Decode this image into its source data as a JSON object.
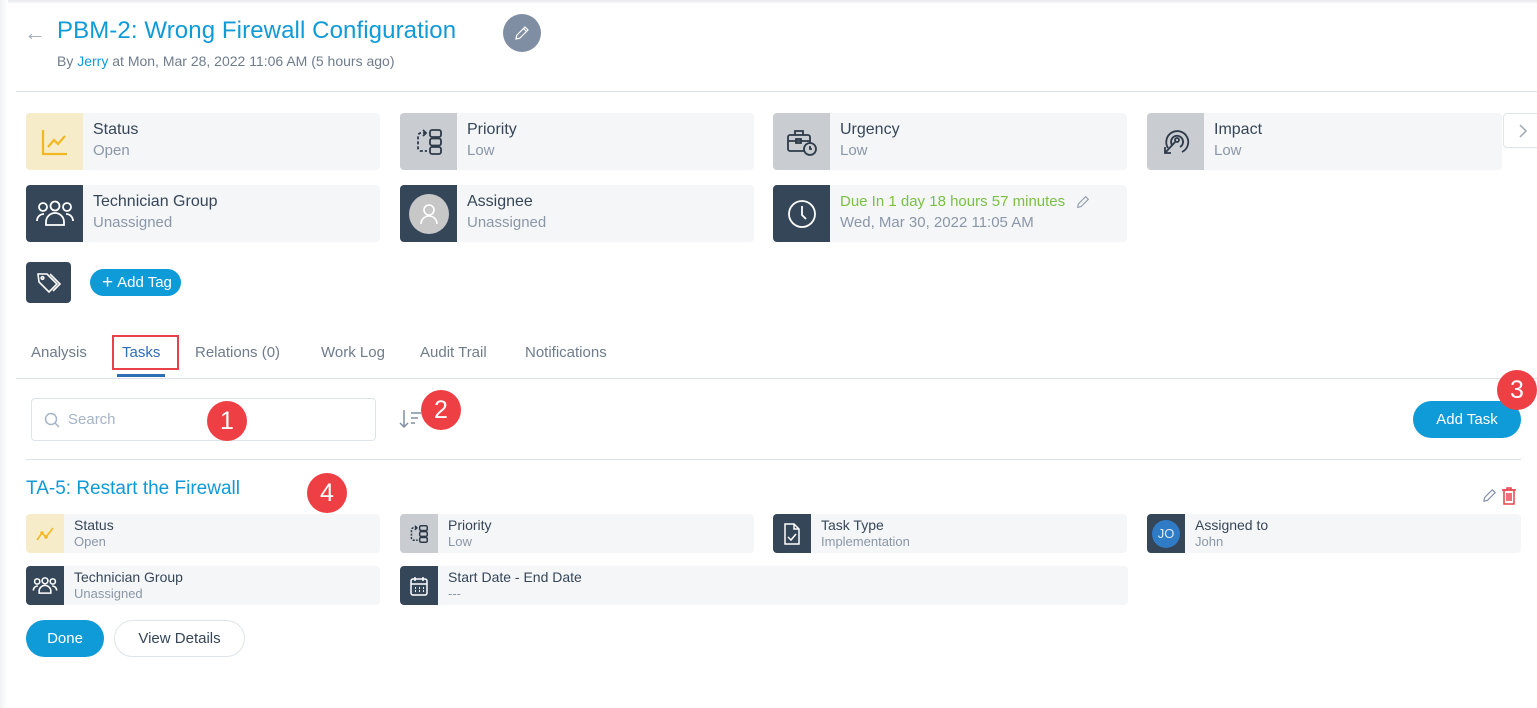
{
  "header": {
    "back_icon": "arrow-left-icon",
    "title": "PBM-2: Wrong Firewall Configuration",
    "edit_icon": "pencil-icon",
    "subtitle_prefix": "By ",
    "author": "Jerry",
    "subtitle_suffix": " at Mon, Mar 28, 2022 11:06 AM (5 hours ago)"
  },
  "info_cards": [
    {
      "label": "Status",
      "value": "Open",
      "icon": "trend-chart-icon"
    },
    {
      "label": "Priority",
      "value": "Low",
      "icon": "priority-flow-icon"
    },
    {
      "label": "Urgency",
      "value": "Low",
      "icon": "briefcase-clock-icon"
    },
    {
      "label": "Impact",
      "value": "Low",
      "icon": "target-icon"
    },
    {
      "label": "Technician Group",
      "value": "Unassigned",
      "icon": "group-icon"
    },
    {
      "label": "Assignee",
      "value": "Unassigned",
      "icon": "user-avatar-icon"
    },
    {
      "label": "Due In  1 day 18 hours 57 minutes",
      "value": "Wed, Mar 30, 2022 11:05 AM",
      "icon": "clock-icon"
    }
  ],
  "next_icon": "chevron-right-icon",
  "tags": {
    "icon": "tag-icon",
    "add_label": "Add Tag"
  },
  "tabs": [
    {
      "label": "Analysis"
    },
    {
      "label": "Tasks",
      "active": true
    },
    {
      "label": "Relations (0)"
    },
    {
      "label": "Work Log"
    },
    {
      "label": "Audit Trail"
    },
    {
      "label": "Notifications"
    }
  ],
  "toolbar": {
    "search_placeholder": "Search",
    "search_value": "",
    "sort_icon": "sort-icon",
    "add_task_label": "Add Task"
  },
  "annotations": [
    "1",
    "2",
    "3",
    "4"
  ],
  "task": {
    "title": "TA-5: Restart the Firewall",
    "fields": [
      {
        "label": "Status",
        "value": "Open",
        "icon": "trend-chart-icon"
      },
      {
        "label": "Priority",
        "value": "Low",
        "icon": "priority-flow-icon"
      },
      {
        "label": "Task Type",
        "value": "Implementation",
        "icon": "document-check-icon"
      },
      {
        "label": "Assigned to",
        "value": "John",
        "avatar_initials": "JO"
      },
      {
        "label": "Technician Group",
        "value": "Unassigned",
        "icon": "group-icon"
      },
      {
        "label": "Start Date - End Date",
        "value": "---",
        "icon": "calendar-icon"
      }
    ],
    "done_label": "Done",
    "view_details_label": "View Details"
  },
  "colors": {
    "primary": "#0f9ad8",
    "due_green": "#7ac043",
    "annotation_red": "#ee3f44",
    "dark_icon_bg": "#364659",
    "delete_red": "#e8414a"
  }
}
